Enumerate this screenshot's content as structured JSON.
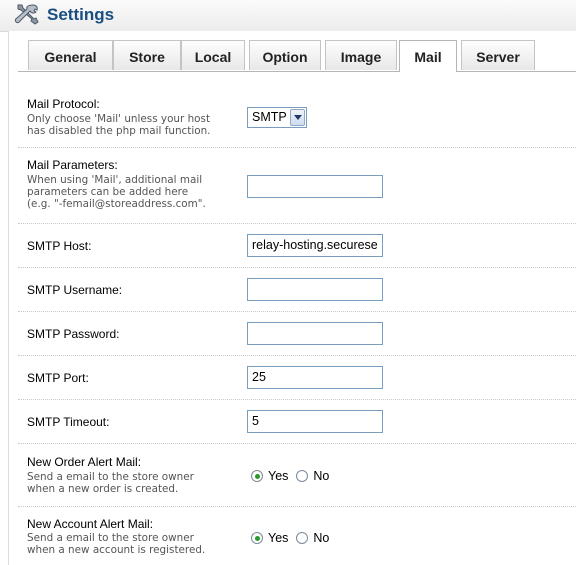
{
  "header": {
    "title": "Settings",
    "icon": "settings-tools-icon"
  },
  "tabs": [
    {
      "label": "General",
      "active": false
    },
    {
      "label": "Store",
      "active": false
    },
    {
      "label": "Local",
      "active": false
    },
    {
      "label": "Option",
      "active": false
    },
    {
      "label": "Image",
      "active": false
    },
    {
      "label": "Mail",
      "active": true
    },
    {
      "label": "Server",
      "active": false
    }
  ],
  "mail": {
    "protocol": {
      "label": "Mail Protocol:",
      "help": "Only choose 'Mail' unless your host\nhas disabled the php mail function.",
      "value": "SMTP"
    },
    "parameters": {
      "label": "Mail Parameters:",
      "help": "When using 'Mail', additional mail\nparameters can be added here\n(e.g. \"-femail@storeaddress.com\".",
      "value": ""
    },
    "smtp_host": {
      "label": "SMTP Host:",
      "value": "relay-hosting.securese"
    },
    "smtp_username": {
      "label": "SMTP Username:",
      "value": ""
    },
    "smtp_password": {
      "label": "SMTP Password:",
      "value": ""
    },
    "smtp_port": {
      "label": "SMTP Port:",
      "value": "25"
    },
    "smtp_timeout": {
      "label": "SMTP Timeout:",
      "value": "5"
    },
    "new_order_alert": {
      "label": "New Order Alert Mail:",
      "help": "Send a email to the store owner\nwhen a new order is created.",
      "yes_label": "Yes",
      "no_label": "No",
      "selected": "Yes"
    },
    "new_account_alert": {
      "label": "New Account Alert Mail:",
      "help": "Send a email to the store owner\nwhen a new account is registered.",
      "yes_label": "Yes",
      "no_label": "No",
      "selected": "Yes"
    }
  },
  "colors": {
    "title": "#1a4d80",
    "radio_checked": "#2a9a2a",
    "input_border": "#7a9cbf"
  }
}
